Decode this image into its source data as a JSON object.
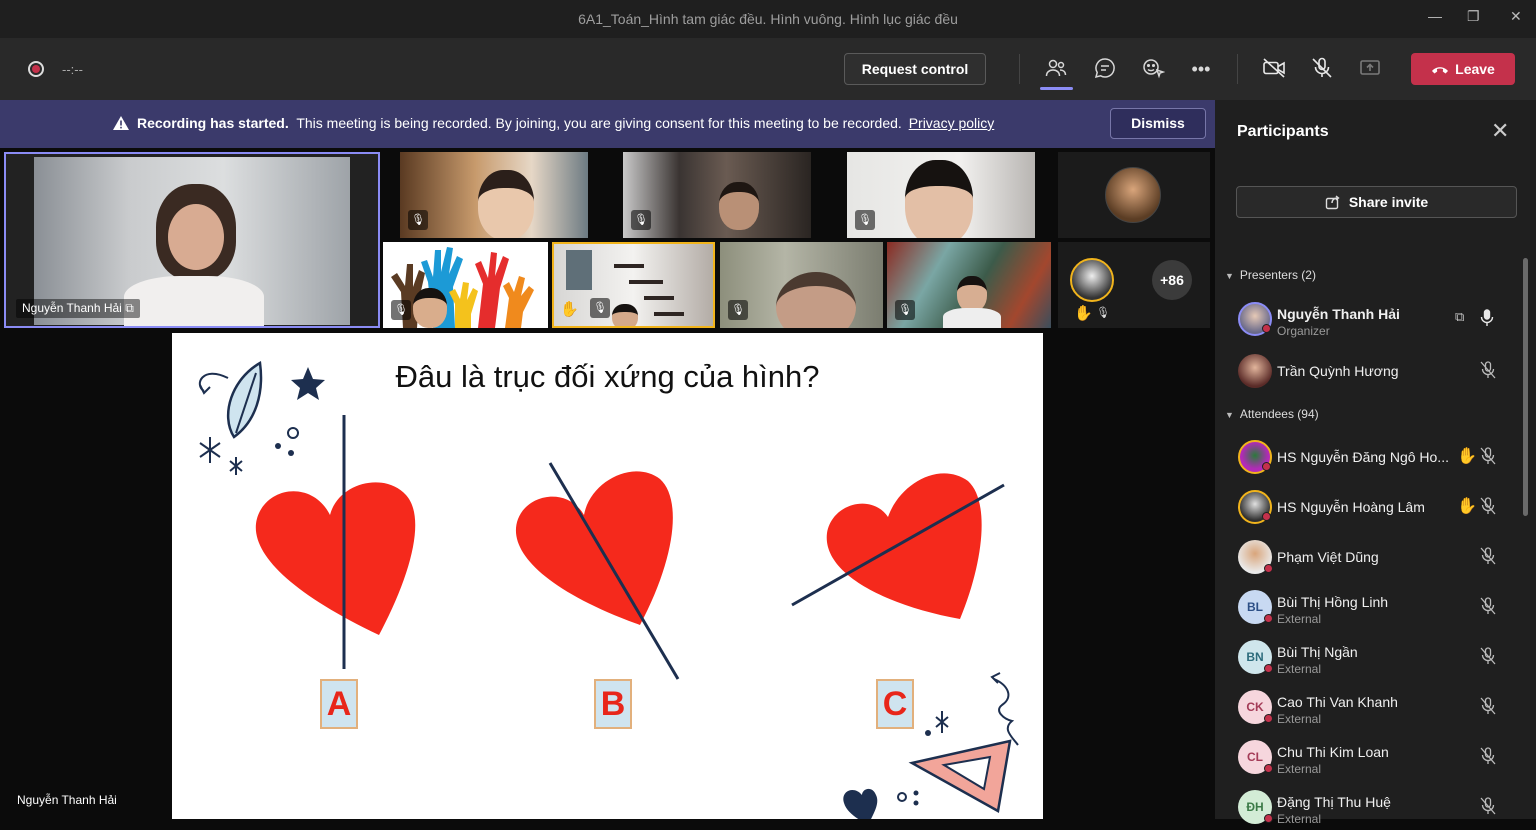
{
  "window": {
    "title": "6A1_Toán_Hình tam giác đều. Hình vuông. Hình lục giác đều",
    "minimize": "—",
    "maximize": "❐",
    "close": "✕"
  },
  "toolbar": {
    "timer": "--:--",
    "request_control": "Request control",
    "leave": "Leave",
    "more": "•••"
  },
  "banner": {
    "bold": "Recording has started.",
    "text": "This meeting is being recorded. By joining, you are giving consent for this meeting to be recorded.",
    "link": "Privacy policy",
    "dismiss": "Dismiss"
  },
  "video": {
    "main_tile_name": "Nguyễn Thanh Hải",
    "overflow_count": "+86",
    "presenter_name": "Nguyễn Thanh Hải"
  },
  "slide": {
    "title": "Đâu là trục đối xứng của hình?",
    "options": [
      "A",
      "B",
      "C"
    ]
  },
  "panel": {
    "title": "Participants",
    "share_invite": "Share invite",
    "presenters_label": "Presenters (2)",
    "attendees_label": "Attendees (94)",
    "presenters": [
      {
        "name": "Nguyễn Thanh Hải",
        "sub": "Organizer",
        "initials": ""
      },
      {
        "name": "Trần Quỳnh Hương",
        "sub": "",
        "initials": ""
      }
    ],
    "attendees": [
      {
        "name": "HS Nguyễn Đăng Ngô Ho...",
        "sub": "",
        "initials": "",
        "hand": true
      },
      {
        "name": "HS Nguyễn Hoàng Lâm",
        "sub": "",
        "initials": "",
        "hand": true
      },
      {
        "name": "Phạm Việt Dũng",
        "sub": "",
        "initials": ""
      },
      {
        "name": "Bùi Thị Hồng Linh",
        "sub": "External",
        "initials": "BL"
      },
      {
        "name": "Bùi Thị Ngần",
        "sub": "External",
        "initials": "BN"
      },
      {
        "name": "Cao Thi Van Khanh",
        "sub": "External",
        "initials": "CK"
      },
      {
        "name": "Chu Thi Kim Loan",
        "sub": "External",
        "initials": "CL"
      },
      {
        "name": "Đặng Thị Thu Huệ",
        "sub": "External",
        "initials": "ĐH"
      }
    ]
  },
  "colors": {
    "accent": "#8b8cf5",
    "leave": "#c4314b",
    "banner": "#3b3a6b",
    "heart": "#f5291c"
  }
}
